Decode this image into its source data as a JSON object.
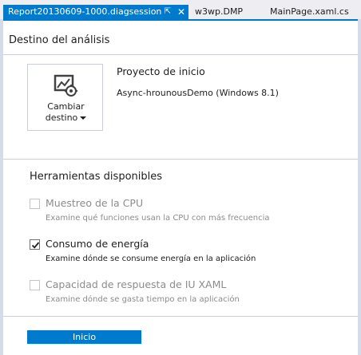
{
  "tabs": [
    {
      "label": "Report20130609-1000.diagsession",
      "active": true
    },
    {
      "label": "w3wp.DMP",
      "active": false
    },
    {
      "label": "MainPage.xaml.cs",
      "active": false
    }
  ],
  "tab_icons": {
    "pin": "pin-icon",
    "close": "close-icon"
  },
  "target": {
    "title": "Destino del análisis",
    "change_button": {
      "line1": "Cambiar",
      "line2": "destino",
      "icon": "chart-gear-icon"
    },
    "project_heading": "Proyecto de inicio",
    "project_name": "Async-hrounousDemo (Windows 8.1)"
  },
  "tools": {
    "title": "Herramientas disponibles",
    "items": [
      {
        "name": "Muestreo de la CPU",
        "description": "Examine qué funciones usan la CPU con más frecuencia",
        "checked": false,
        "enabled": false
      },
      {
        "name": "Consumo de energía",
        "description": "Examine dónde se consume energía en la aplicación",
        "checked": true,
        "enabled": true
      },
      {
        "name": "Capacidad de respuesta de IU XAML",
        "description": "Examine dónde se gasta tiempo en la aplicación",
        "checked": false,
        "enabled": false
      }
    ]
  },
  "start_button": "Inicio",
  "colors": {
    "accent": "#007acc",
    "frame": "#d6dbe9",
    "disabled_text": "#8c8c8c"
  }
}
